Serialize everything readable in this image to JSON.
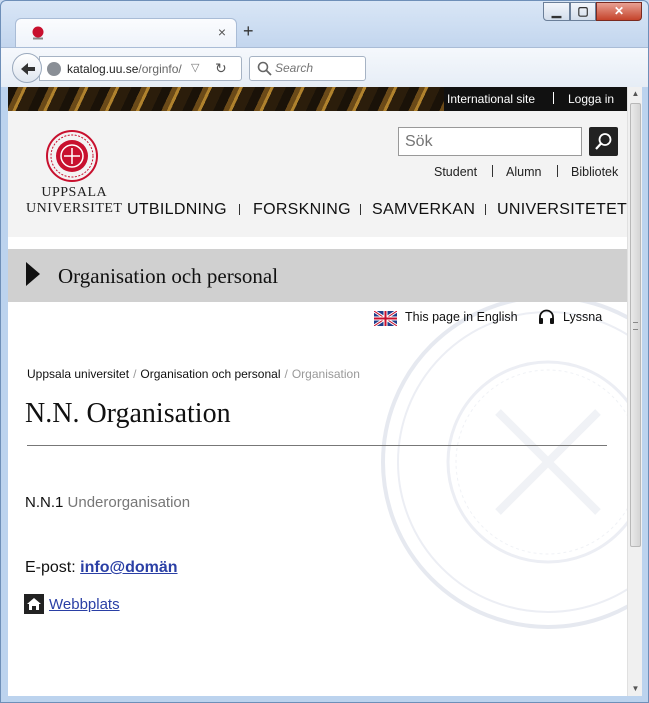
{
  "browser": {
    "url_domain": "katalog.uu.se",
    "url_path": "/orginfo/",
    "url_prefix": "",
    "search_placeholder": "Search",
    "new_tab": "+",
    "tab_close": "×",
    "window": {
      "minimize": "▁",
      "maximize": "▢",
      "close": "✕"
    }
  },
  "site": {
    "top_links": [
      "International site",
      "Logga in"
    ],
    "logo_line1": "UPPSALA",
    "logo_line2": "UNIVERSITET",
    "search_placeholder": "Sök",
    "quick_links": [
      "Student",
      "Alumn",
      "Bibliotek"
    ],
    "main_nav": [
      "UTBILDNING",
      "FORSKNING",
      "SAMVERKAN",
      "UNIVERSITETET"
    ],
    "section_title": "Organisation och personal",
    "english_link": "This page in English",
    "listen_link": "Lyssna",
    "breadcrumb": [
      "Uppsala universitet",
      "Organisation och personal",
      "Organisation"
    ],
    "page_title": "N.N. Organisation",
    "suborg_code": "N.N.1",
    "suborg_label": "Underorganisation",
    "email_label": "E-post:",
    "email_value": "info@domän",
    "website_label": "Webbplats"
  },
  "colors": {
    "link": "#2a3fa5",
    "logo_red": "#c8102e",
    "section_bar": "#d0d0d0"
  }
}
